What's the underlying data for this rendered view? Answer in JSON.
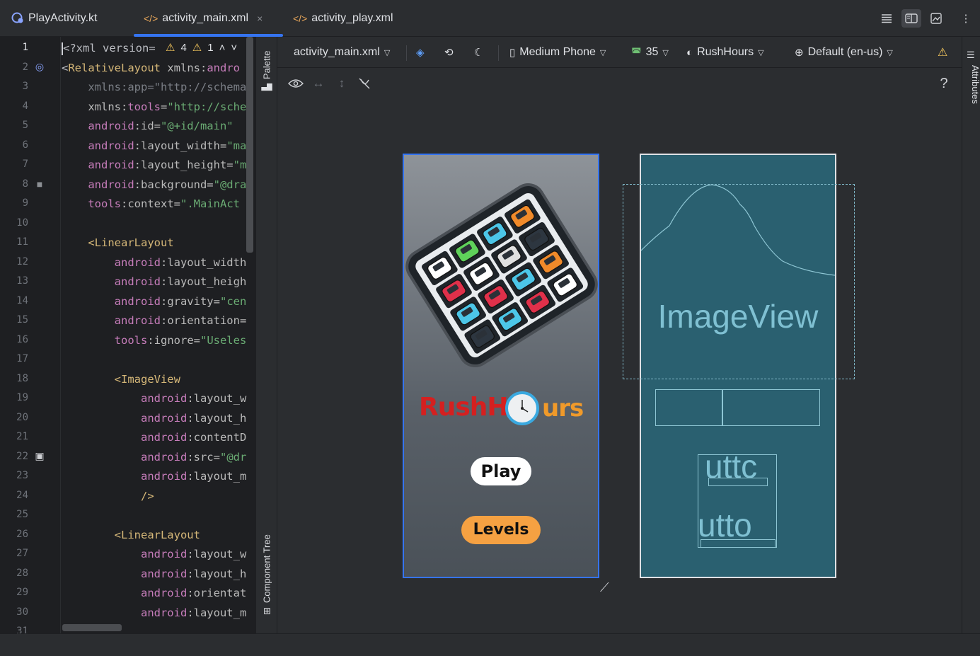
{
  "tabs": [
    {
      "label": "PlayActivity.kt",
      "icon": "kotlin-icon",
      "active": false
    },
    {
      "label": "activity_main.xml",
      "icon": "xml-icon",
      "active": true,
      "close": "×"
    },
    {
      "label": "activity_play.xml",
      "icon": "xml-icon",
      "active": false
    }
  ],
  "editor": {
    "line_numbers": [
      "1",
      "2",
      "3",
      "4",
      "5",
      "6",
      "7",
      "8",
      "9",
      "10",
      "11",
      "12",
      "13",
      "14",
      "15",
      "16",
      "17",
      "18",
      "19",
      "20",
      "21",
      "22",
      "23",
      "24",
      "25",
      "26",
      "27",
      "28",
      "29",
      "30",
      "31"
    ],
    "inspection": {
      "warnings": "4",
      "weak_warnings": "1"
    },
    "lines": [
      [
        {
          "c": "t-plain",
          "t": "<?xml version="
        }
      ],
      [
        {
          "c": "t-plain",
          "t": "<"
        },
        {
          "c": "t-tag",
          "t": "RelativeLayout "
        },
        {
          "c": "t-attr",
          "t": "xmlns:"
        },
        {
          "c": "t-ns",
          "t": "andro"
        }
      ],
      [
        {
          "c": "t-grey",
          "t": "    xmlns:app=\"http://schema"
        }
      ],
      [
        {
          "c": "t-attr",
          "t": "    xmlns:"
        },
        {
          "c": "t-ns",
          "t": "tools"
        },
        {
          "c": "t-attr",
          "t": "="
        },
        {
          "c": "t-val",
          "t": "\"http://sche"
        }
      ],
      [
        {
          "c": "t-ns",
          "t": "    android"
        },
        {
          "c": "t-attr",
          "t": ":id="
        },
        {
          "c": "t-val",
          "t": "\"@+id/main\""
        }
      ],
      [
        {
          "c": "t-ns",
          "t": "    android"
        },
        {
          "c": "t-attr",
          "t": ":layout_width="
        },
        {
          "c": "t-val",
          "t": "\"ma"
        }
      ],
      [
        {
          "c": "t-ns",
          "t": "    android"
        },
        {
          "c": "t-attr",
          "t": ":layout_height="
        },
        {
          "c": "t-val",
          "t": "\"m"
        }
      ],
      [
        {
          "c": "t-ns",
          "t": "    android"
        },
        {
          "c": "t-attr",
          "t": ":background="
        },
        {
          "c": "t-val",
          "t": "\"@dra"
        }
      ],
      [
        {
          "c": "t-ns",
          "t": "    tools"
        },
        {
          "c": "t-attr",
          "t": ":context="
        },
        {
          "c": "t-val",
          "t": "\".MainAct"
        }
      ],
      [
        {
          "c": "t-plain",
          "t": ""
        }
      ],
      [
        {
          "c": "t-tag",
          "t": "    <LinearLayout"
        }
      ],
      [
        {
          "c": "t-ns",
          "t": "        android"
        },
        {
          "c": "t-attr",
          "t": ":layout_width"
        }
      ],
      [
        {
          "c": "t-ns",
          "t": "        android"
        },
        {
          "c": "t-attr",
          "t": ":layout_heigh"
        }
      ],
      [
        {
          "c": "t-ns",
          "t": "        android"
        },
        {
          "c": "t-attr",
          "t": ":gravity="
        },
        {
          "c": "t-val",
          "t": "\"cen"
        }
      ],
      [
        {
          "c": "t-ns",
          "t": "        android"
        },
        {
          "c": "t-attr",
          "t": ":orientation="
        }
      ],
      [
        {
          "c": "t-ns",
          "t": "        tools"
        },
        {
          "c": "t-attr",
          "t": ":ignore="
        },
        {
          "c": "t-val",
          "t": "\"Useles"
        }
      ],
      [
        {
          "c": "t-plain",
          "t": ""
        }
      ],
      [
        {
          "c": "t-tag",
          "t": "        <ImageView"
        }
      ],
      [
        {
          "c": "t-ns",
          "t": "            android"
        },
        {
          "c": "t-attr",
          "t": ":layout_w"
        }
      ],
      [
        {
          "c": "t-ns",
          "t": "            android"
        },
        {
          "c": "t-attr",
          "t": ":layout_h"
        }
      ],
      [
        {
          "c": "t-ns",
          "t": "            android"
        },
        {
          "c": "t-attr",
          "t": ":contentD"
        }
      ],
      [
        {
          "c": "t-ns",
          "t": "            android"
        },
        {
          "c": "t-attr",
          "t": ":src="
        },
        {
          "c": "t-val",
          "t": "\"@dr"
        }
      ],
      [
        {
          "c": "t-ns",
          "t": "            android"
        },
        {
          "c": "t-attr",
          "t": ":layout_m"
        }
      ],
      [
        {
          "c": "t-tag",
          "t": "            />"
        }
      ],
      [
        {
          "c": "t-plain",
          "t": ""
        }
      ],
      [
        {
          "c": "t-tag",
          "t": "        <LinearLayout"
        }
      ],
      [
        {
          "c": "t-ns",
          "t": "            android"
        },
        {
          "c": "t-attr",
          "t": ":layout_w"
        }
      ],
      [
        {
          "c": "t-ns",
          "t": "            android"
        },
        {
          "c": "t-attr",
          "t": ":layout_h"
        }
      ],
      [
        {
          "c": "t-ns",
          "t": "            android"
        },
        {
          "c": "t-attr",
          "t": ":orientat"
        }
      ],
      [
        {
          "c": "t-ns",
          "t": "            android"
        },
        {
          "c": "t-attr",
          "t": ":layout_m"
        }
      ],
      [
        {
          "c": "t-plain",
          "t": ""
        }
      ]
    ]
  },
  "side_panels": {
    "palette": "Palette",
    "component_tree": "Component Tree",
    "attributes": "Attributes"
  },
  "design_toolbar": {
    "file": "activity_main.xml",
    "device": "Medium Phone",
    "api": "35",
    "theme": "RushHours",
    "locale": "Default (en-us)"
  },
  "design_toolbar2": {
    "help": "?"
  },
  "preview": {
    "title_part1": "RushH",
    "title_part2": "urs",
    "play_label": "Play",
    "levels_label": "Levels"
  },
  "blueprint": {
    "imageview_label": "ImageView",
    "button1_text": "uttc",
    "button2_text": "utto"
  },
  "colors": {
    "accent": "#3574f0",
    "title_red": "#d42020",
    "title_orange": "#f09a2a",
    "levels_orange": "#f5a142"
  }
}
